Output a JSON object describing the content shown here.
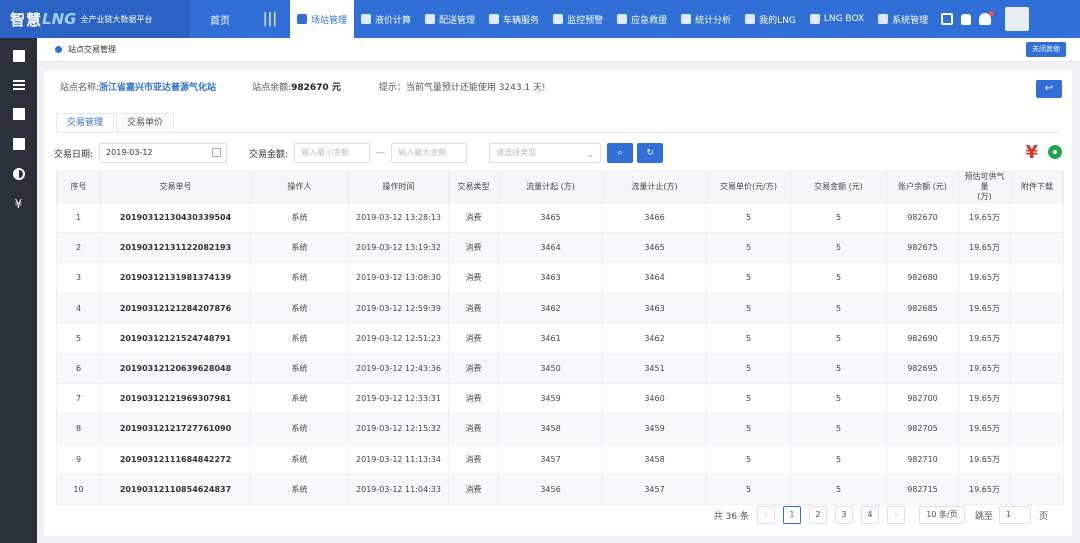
{
  "header": {
    "logo_main": "智慧",
    "logo_lng": "LNG",
    "logo_sub": "全产业链大数据平台",
    "home": "首页",
    "nav": [
      {
        "label": "场站管理",
        "active": true,
        "icon": "layers-icon"
      },
      {
        "label": "液价计算",
        "active": false,
        "icon": "calc-icon"
      },
      {
        "label": "配送管理",
        "active": false,
        "icon": "truck-icon"
      },
      {
        "label": "车辆服务",
        "active": false,
        "icon": "car-icon"
      },
      {
        "label": "监控预警",
        "active": false,
        "icon": "monitor-icon"
      },
      {
        "label": "应急救援",
        "active": false,
        "icon": "rescue-icon"
      },
      {
        "label": "统计分析",
        "active": false,
        "icon": "chart-icon"
      },
      {
        "label": "我的LNG",
        "active": false,
        "icon": "user-icon"
      },
      {
        "label": "LNG BOX",
        "active": false,
        "icon": "box-icon"
      },
      {
        "label": "系统管理",
        "active": false,
        "icon": "windows-icon"
      }
    ]
  },
  "tabbar": {
    "open_tab": "站点交易管理",
    "close_all": "关闭其他"
  },
  "info": {
    "station_label": "站点名称:",
    "station_name": "浙江省嘉兴市亚达普源气化站",
    "balance_label": "站点余额:",
    "balance_value": "982670 元",
    "hint": "提示：当前气量预计还能使用 3243.1 天!"
  },
  "subtabs": [
    "交易管理",
    "交易单价"
  ],
  "filters": {
    "date_label": "交易日期:",
    "date_value": "2019-03-12",
    "amount_label": "交易金额:",
    "amount_min_placeholder": "输入最小金额",
    "amount_max_placeholder": "输入最大金额",
    "type_placeholder": "请选择类型"
  },
  "table": {
    "headers": [
      "序号",
      "交易单号",
      "操作人",
      "操作时间",
      "交易类型",
      "流量计起 (方)",
      "流量计止(方)",
      "交易单价(元/方)",
      "交易金额 (元)",
      "账户余额 (元)",
      "预估可供气量\n(万)",
      "附件下载"
    ],
    "rows": [
      [
        "1",
        "20190312130430339504",
        "系统",
        "2019-03-12 13:28:13",
        "消费",
        "3465",
        "3466",
        "5",
        "5",
        "982670",
        "19.65万",
        ""
      ],
      [
        "2",
        "20190312131122082193",
        "系统",
        "2019-03-12 13:19:32",
        "消费",
        "3464",
        "3465",
        "5",
        "5",
        "982675",
        "19.65万",
        ""
      ],
      [
        "3",
        "20190312131981374139",
        "系统",
        "2019-03-12 13:08:30",
        "消费",
        "3463",
        "3464",
        "5",
        "5",
        "982680",
        "19.65万",
        ""
      ],
      [
        "4",
        "20190312121284207876",
        "系统",
        "2019-03-12 12:59:39",
        "消费",
        "3462",
        "3463",
        "5",
        "5",
        "982685",
        "19.65万",
        ""
      ],
      [
        "5",
        "20190312121524748791",
        "系统",
        "2019-03-12 12:51:23",
        "消费",
        "3461",
        "3462",
        "5",
        "5",
        "982690",
        "19.65万",
        ""
      ],
      [
        "6",
        "20190312120639628048",
        "系统",
        "2019-03-12 12:43:36",
        "消费",
        "3450",
        "3451",
        "5",
        "5",
        "982695",
        "19.65万",
        ""
      ],
      [
        "7",
        "20190312121969307981",
        "系统",
        "2019-03-12 12:33:31",
        "消费",
        "3459",
        "3460",
        "5",
        "5",
        "982700",
        "19.65万",
        ""
      ],
      [
        "8",
        "20190312121727761090",
        "系统",
        "2019-03-12 12:15:32",
        "消费",
        "3458",
        "3459",
        "5",
        "5",
        "982705",
        "19.65万",
        ""
      ],
      [
        "9",
        "20190312111684842272",
        "系统",
        "2019-03-12 11:13:34",
        "消费",
        "3457",
        "3458",
        "5",
        "5",
        "982710",
        "19.65万",
        ""
      ],
      [
        "10",
        "20190312110854624837",
        "系统",
        "2019-03-12 11:04:33",
        "消费",
        "3456",
        "3457",
        "5",
        "5",
        "982715",
        "19.65万",
        ""
      ]
    ]
  },
  "pagination": {
    "total": "共 36 条",
    "pages": [
      "1",
      "2",
      "3",
      "4"
    ],
    "current": "1",
    "page_size": "10 条/页",
    "goto_label": "跳至",
    "goto_value": "1",
    "page_suffix": "页"
  },
  "colors": {
    "brand": "#2f6fd6",
    "yuan": "#d63a2a",
    "gear": "#1fa64a"
  }
}
